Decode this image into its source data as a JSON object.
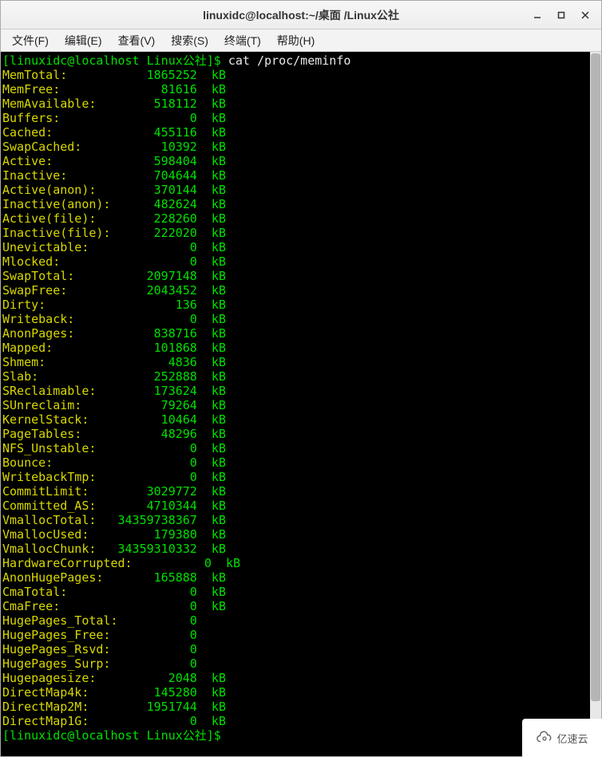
{
  "window": {
    "title": "linuxidc@localhost:~/桌面 /Linux公社"
  },
  "menu": {
    "file": "文件(F)",
    "edit": "编辑(E)",
    "view": "查看(V)",
    "search": "搜索(S)",
    "terminal": "终端(T)",
    "help": "帮助(H)"
  },
  "prompt": {
    "open": "[",
    "user_host": "linuxidc@localhost",
    "sep": " ",
    "cwd": "Linux公社",
    "close": "]$ ",
    "command": "cat /proc/meminfo"
  },
  "meminfo": [
    {
      "key": "MemTotal:",
      "value": "1865252",
      "unit": "kB"
    },
    {
      "key": "MemFree:",
      "value": "81616",
      "unit": "kB"
    },
    {
      "key": "MemAvailable:",
      "value": "518112",
      "unit": "kB"
    },
    {
      "key": "Buffers:",
      "value": "0",
      "unit": "kB"
    },
    {
      "key": "Cached:",
      "value": "455116",
      "unit": "kB"
    },
    {
      "key": "SwapCached:",
      "value": "10392",
      "unit": "kB"
    },
    {
      "key": "Active:",
      "value": "598404",
      "unit": "kB"
    },
    {
      "key": "Inactive:",
      "value": "704644",
      "unit": "kB"
    },
    {
      "key": "Active(anon):",
      "value": "370144",
      "unit": "kB"
    },
    {
      "key": "Inactive(anon):",
      "value": "482624",
      "unit": "kB"
    },
    {
      "key": "Active(file):",
      "value": "228260",
      "unit": "kB"
    },
    {
      "key": "Inactive(file):",
      "value": "222020",
      "unit": "kB"
    },
    {
      "key": "Unevictable:",
      "value": "0",
      "unit": "kB"
    },
    {
      "key": "Mlocked:",
      "value": "0",
      "unit": "kB"
    },
    {
      "key": "SwapTotal:",
      "value": "2097148",
      "unit": "kB"
    },
    {
      "key": "SwapFree:",
      "value": "2043452",
      "unit": "kB"
    },
    {
      "key": "Dirty:",
      "value": "136",
      "unit": "kB"
    },
    {
      "key": "Writeback:",
      "value": "0",
      "unit": "kB"
    },
    {
      "key": "AnonPages:",
      "value": "838716",
      "unit": "kB"
    },
    {
      "key": "Mapped:",
      "value": "101868",
      "unit": "kB"
    },
    {
      "key": "Shmem:",
      "value": "4836",
      "unit": "kB"
    },
    {
      "key": "Slab:",
      "value": "252888",
      "unit": "kB"
    },
    {
      "key": "SReclaimable:",
      "value": "173624",
      "unit": "kB"
    },
    {
      "key": "SUnreclaim:",
      "value": "79264",
      "unit": "kB"
    },
    {
      "key": "KernelStack:",
      "value": "10464",
      "unit": "kB"
    },
    {
      "key": "PageTables:",
      "value": "48296",
      "unit": "kB"
    },
    {
      "key": "NFS_Unstable:",
      "value": "0",
      "unit": "kB"
    },
    {
      "key": "Bounce:",
      "value": "0",
      "unit": "kB"
    },
    {
      "key": "WritebackTmp:",
      "value": "0",
      "unit": "kB"
    },
    {
      "key": "CommitLimit:",
      "value": "3029772",
      "unit": "kB"
    },
    {
      "key": "Committed_AS:",
      "value": "4710344",
      "unit": "kB"
    },
    {
      "key": "VmallocTotal:",
      "value": "34359738367",
      "unit": "kB"
    },
    {
      "key": "VmallocUsed:",
      "value": "179380",
      "unit": "kB"
    },
    {
      "key": "VmallocChunk:",
      "value": "34359310332",
      "unit": "kB"
    },
    {
      "key": "HardwareCorrupted:",
      "value": "0",
      "unit": "kB"
    },
    {
      "key": "AnonHugePages:",
      "value": "165888",
      "unit": "kB"
    },
    {
      "key": "CmaTotal:",
      "value": "0",
      "unit": "kB"
    },
    {
      "key": "CmaFree:",
      "value": "0",
      "unit": "kB"
    },
    {
      "key": "HugePages_Total:",
      "value": "0",
      "unit": ""
    },
    {
      "key": "HugePages_Free:",
      "value": "0",
      "unit": ""
    },
    {
      "key": "HugePages_Rsvd:",
      "value": "0",
      "unit": ""
    },
    {
      "key": "HugePages_Surp:",
      "value": "0",
      "unit": ""
    },
    {
      "key": "Hugepagesize:",
      "value": "2048",
      "unit": "kB"
    },
    {
      "key": "DirectMap4k:",
      "value": "145280",
      "unit": "kB"
    },
    {
      "key": "DirectMap2M:",
      "value": "1951744",
      "unit": "kB"
    },
    {
      "key": "DirectMap1G:",
      "value": "0",
      "unit": "kB"
    }
  ],
  "prompt2": {
    "open": "[",
    "user_host": "linuxidc@localhost",
    "sep": " ",
    "cwd": "Linux公社",
    "close": "]$ "
  },
  "watermark": {
    "text": "亿速云"
  }
}
